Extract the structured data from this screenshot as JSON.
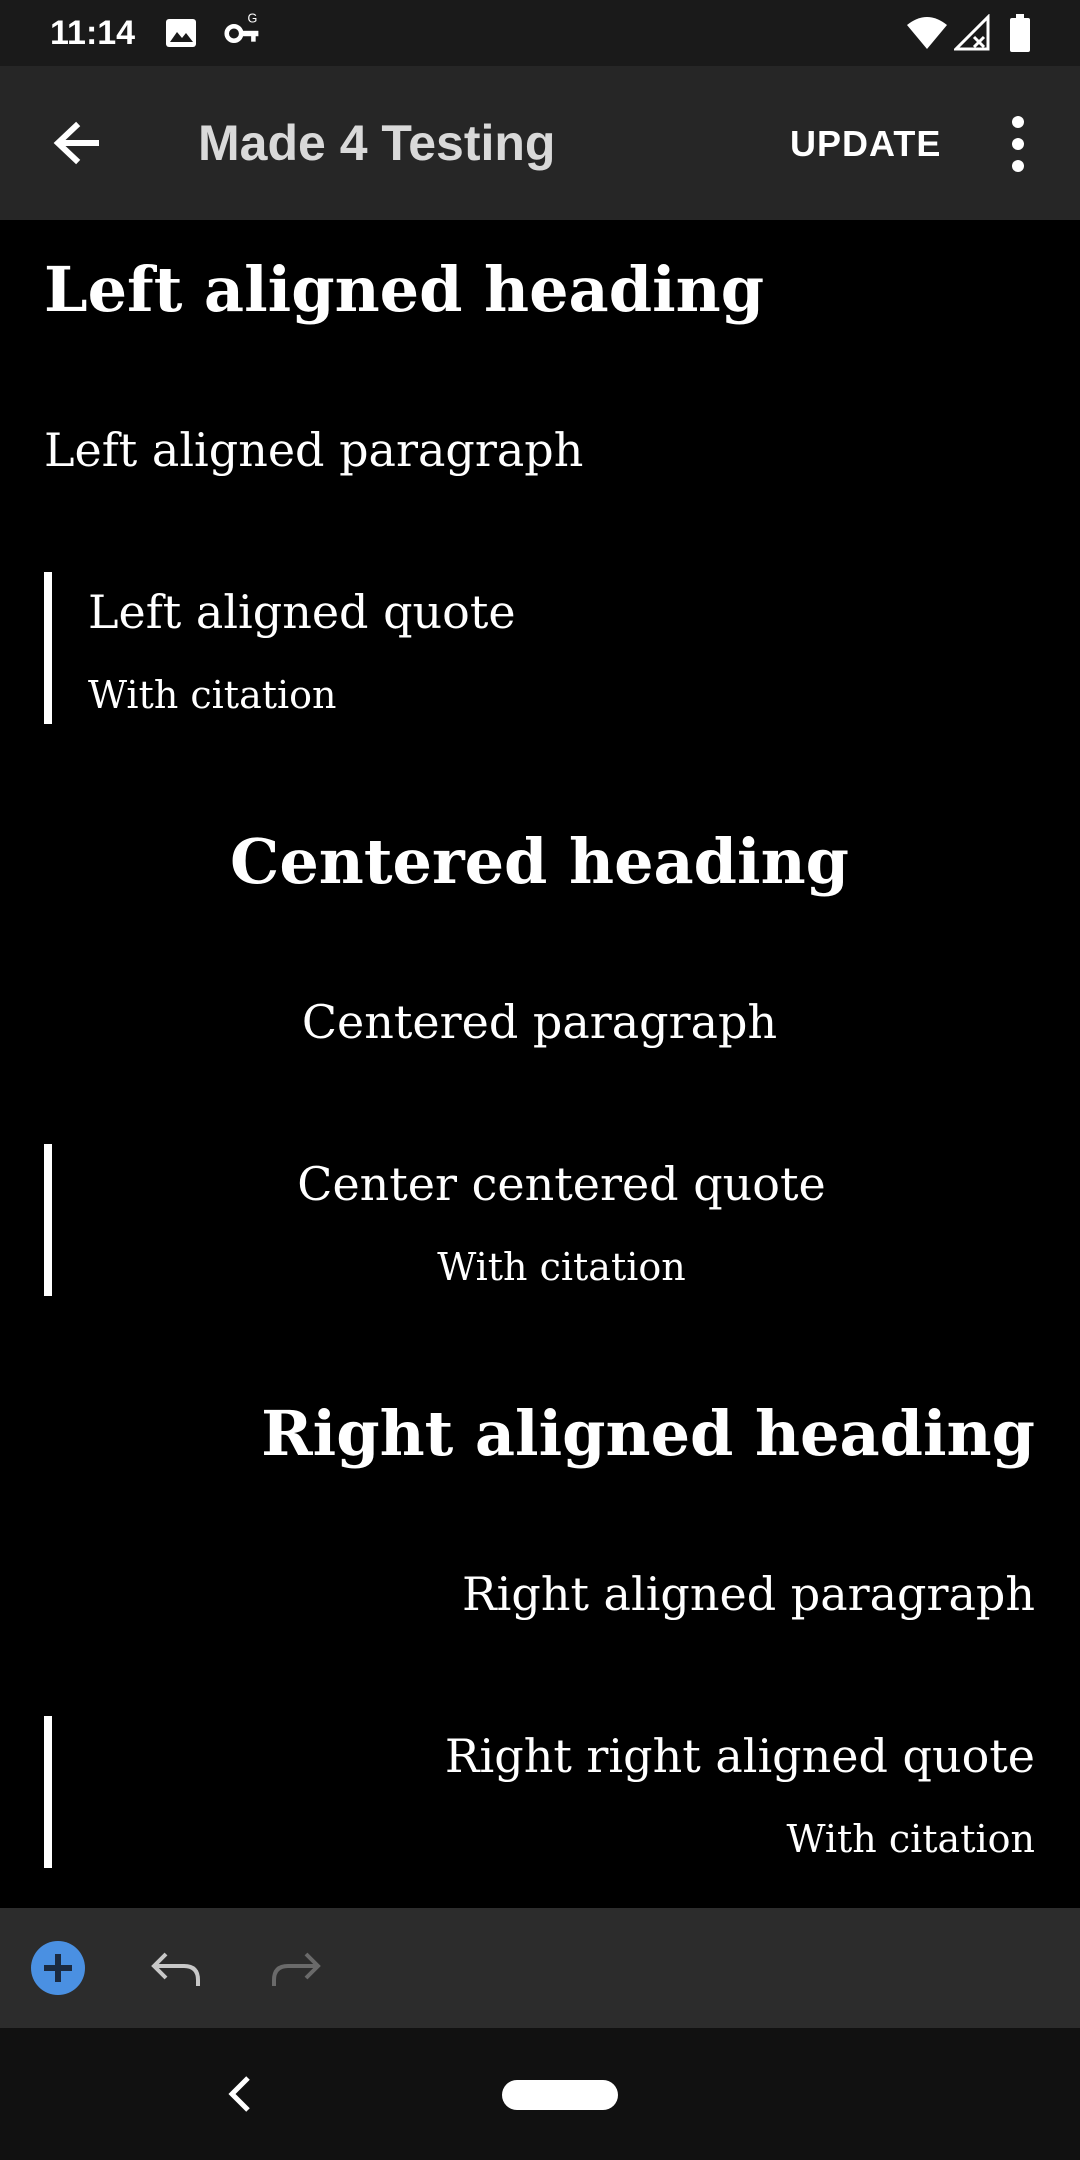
{
  "status_bar": {
    "time": "11:14",
    "icons": [
      "image-icon",
      "vpn-key-icon",
      "wifi-icon",
      "signal-off-icon",
      "battery-icon"
    ]
  },
  "app_bar": {
    "title": "Made 4 Testing",
    "update_label": "UPDATE",
    "icons": [
      "arrow-back-icon",
      "more-vert-icon"
    ]
  },
  "content": {
    "left": {
      "heading": "Left aligned heading",
      "paragraph": "Left aligned paragraph",
      "quote": "Left aligned quote",
      "citation": "With citation"
    },
    "center": {
      "heading": "Centered heading",
      "paragraph": "Centered paragraph",
      "quote": "Center centered quote",
      "citation": "With citation"
    },
    "right": {
      "heading": "Right aligned heading",
      "paragraph": "Right aligned paragraph",
      "quote": "Right right aligned quote",
      "citation": "With citation"
    }
  },
  "toolbar": {
    "icons": [
      "add-circle-icon",
      "undo-icon",
      "redo-icon"
    ],
    "add_color": "#4a90e2",
    "redo_enabled": false
  },
  "nav_bar": {
    "icons": [
      "nav-back-icon",
      "home-pill-icon"
    ]
  },
  "colors": {
    "background": "#000000",
    "app_bar": "#262626",
    "status_bar": "#1a1a1a",
    "toolbar": "#2c2c2c",
    "nav_bar": "#111111",
    "text": "#ffffff",
    "accent": "#4a90e2"
  }
}
